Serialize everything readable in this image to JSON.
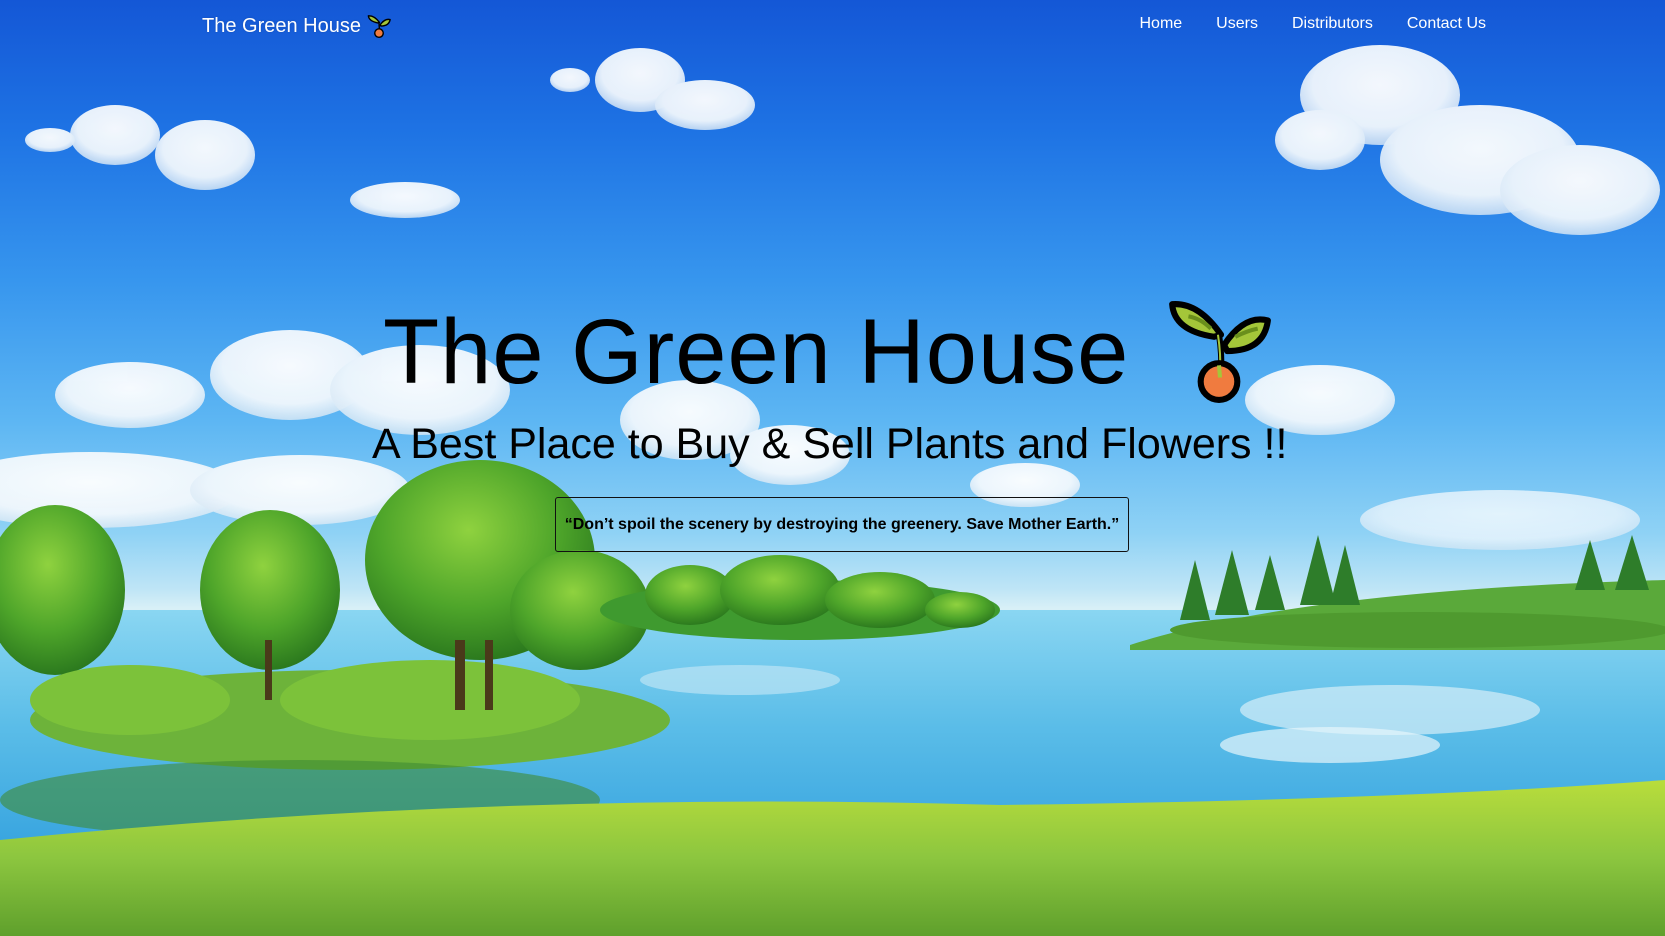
{
  "nav": {
    "brand": "The Green House",
    "brand_icon": "seedling-icon",
    "links": [
      {
        "label": "Home"
      },
      {
        "label": "Users"
      },
      {
        "label": "Distributors"
      },
      {
        "label": "Contact Us"
      }
    ]
  },
  "hero": {
    "title": "The Green House",
    "title_icon": "seedling-icon",
    "subtitle": "A Best Place to Buy & Sell Plants and Flowers !!",
    "quote": "“Don’t spoil the scenery by destroying the greenery. Save Mother Earth.”"
  },
  "colors": {
    "sky_top": "#1457d6",
    "sky_horizon": "#d8f0f7",
    "grass": "#8cc63f",
    "leaf": "#a4c639",
    "seed": "#f07b3f"
  }
}
